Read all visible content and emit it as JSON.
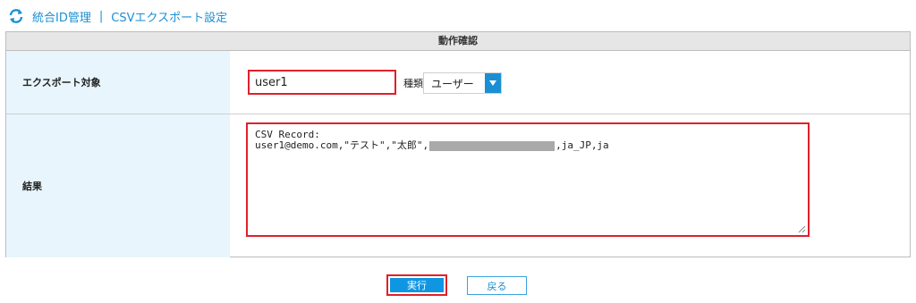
{
  "breadcrumb": {
    "section": "統合ID管理",
    "separator": "|",
    "page": "CSVエクスポート設定"
  },
  "panel": {
    "title": "動作確認"
  },
  "export_target": {
    "label": "エクスポート対象",
    "value": "user1",
    "kind_label": "種類",
    "kind_selected": "ユーザー"
  },
  "result": {
    "label": "結果",
    "line1": "CSV Record:",
    "line2_prefix": "user1@demo.com,\"テスト\",\"太郎\",",
    "line2_suffix": ",ja_JP,ja"
  },
  "buttons": {
    "run": "実行",
    "back": "戻る"
  },
  "colors": {
    "accent": "#1a8fd4",
    "highlight": "#e0202a",
    "label_bg": "#e8f5fc"
  }
}
